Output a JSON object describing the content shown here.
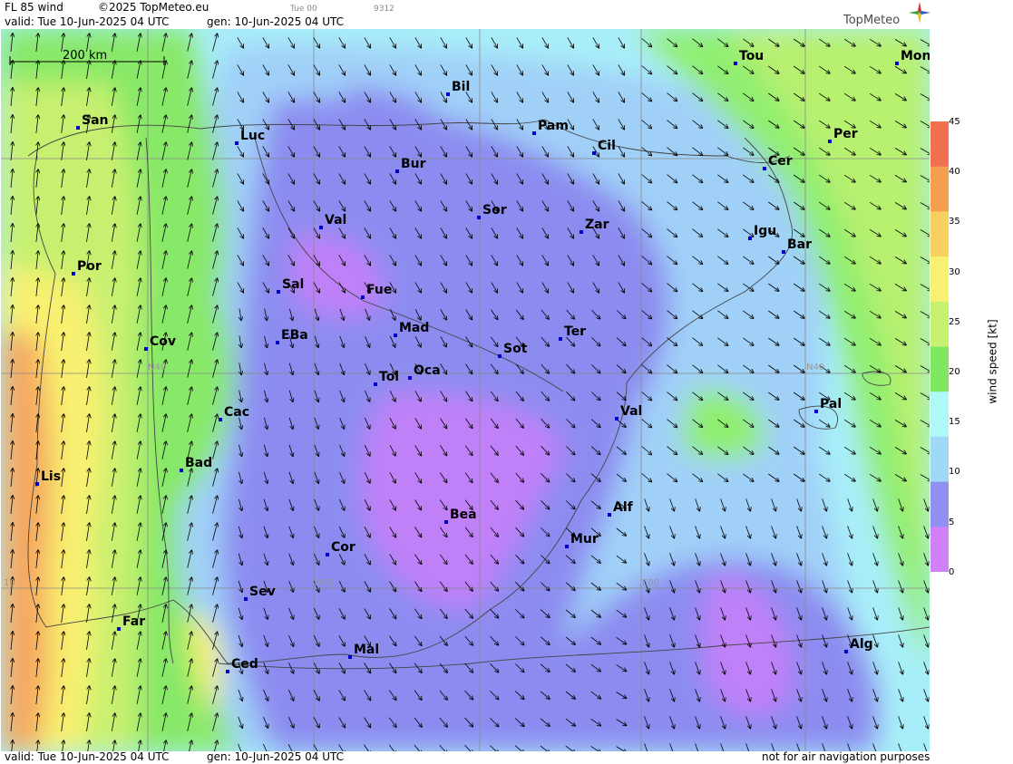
{
  "header": {
    "product": "FL 85 wind",
    "copyright": "©2025 TopMeteo.eu",
    "model_run": "Tue 00",
    "code": "9312",
    "valid": "valid:  Tue  10-Jun-2025  04 UTC",
    "generated": "gen: 10-Jun-2025 04 UTC"
  },
  "logo": {
    "text": "TopMeteo",
    "icon": "compass-star-icon"
  },
  "footer": {
    "valid": "valid:  Tue  10-Jun-2025  04 UTC",
    "generated": "gen: 10-Jun-2025 04 UTC",
    "disclaimer": "not for air navigation purposes"
  },
  "scale_bar": {
    "label": "200 km"
  },
  "grid_labels": {
    "n40_left": "N40",
    "n40_right": "N40",
    "w05": "W05",
    "e00": "E00",
    "w10": "10"
  },
  "legend": {
    "title": "wind speed  [kt]",
    "ticks": [
      "45",
      "40",
      "35",
      "30",
      "25",
      "20",
      "15",
      "10",
      "5",
      "0"
    ],
    "colors": [
      "#f07050",
      "#f5a050",
      "#f8d060",
      "#f8f070",
      "#c8f070",
      "#80e860",
      "#b0f8f8",
      "#a0d8f8",
      "#9090f0",
      "#d080f8"
    ]
  },
  "cities": [
    {
      "name": "Bil"
    },
    {
      "name": "Tou"
    },
    {
      "name": "Mon"
    },
    {
      "name": "San"
    },
    {
      "name": "Luc"
    },
    {
      "name": "Pam"
    },
    {
      "name": "Cil"
    },
    {
      "name": "Per"
    },
    {
      "name": "Bur"
    },
    {
      "name": "Cer"
    },
    {
      "name": "Sor"
    },
    {
      "name": "Val"
    },
    {
      "name": "Zar"
    },
    {
      "name": "Igu"
    },
    {
      "name": "Bar"
    },
    {
      "name": "Por"
    },
    {
      "name": "Sal"
    },
    {
      "name": "Fue"
    },
    {
      "name": "Mad"
    },
    {
      "name": "EBa"
    },
    {
      "name": "Ter"
    },
    {
      "name": "Cov"
    },
    {
      "name": "Sot"
    },
    {
      "name": "Tol"
    },
    {
      "name": "Oca"
    },
    {
      "name": "Pal"
    },
    {
      "name": "Val"
    },
    {
      "name": "Cac"
    },
    {
      "name": "Bad"
    },
    {
      "name": "Lis"
    },
    {
      "name": "Alf"
    },
    {
      "name": "Bea"
    },
    {
      "name": "Mur"
    },
    {
      "name": "Cor"
    },
    {
      "name": "Sev"
    },
    {
      "name": "Far"
    },
    {
      "name": "Alg"
    },
    {
      "name": "Mal"
    },
    {
      "name": "Ced"
    }
  ]
}
